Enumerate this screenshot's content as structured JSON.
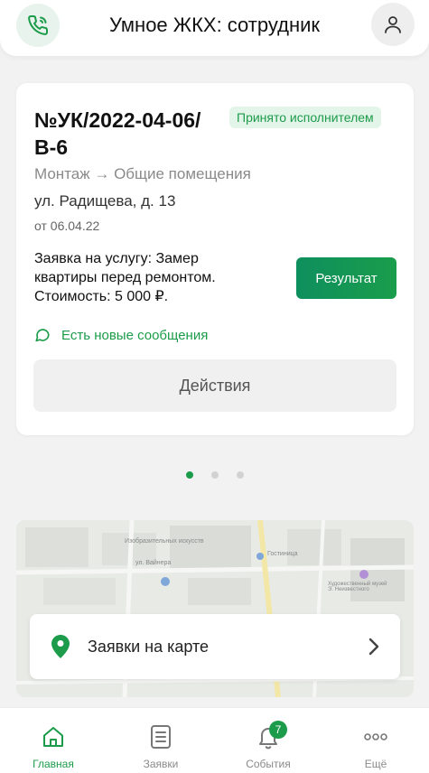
{
  "header": {
    "title": "Умное ЖКХ: сотрудник",
    "left_icon": "phone-icon",
    "right_icon": "user-icon"
  },
  "order_card": {
    "number": "№УК/2022-04-06/В-6",
    "status": "Принято исполнителем",
    "category": "Монтаж → Общие помещения",
    "address": "ул. Радищева, д. 13",
    "date": "от 06.04.22",
    "description": "Заявка на услугу: Замер квартиры перед ремонтом. Стоимость: 5 000 ₽.",
    "result_button": "Результат",
    "messages_notice": "Есть новые сообщения",
    "actions_button": "Действия"
  },
  "pager": {
    "count": 3,
    "active_index": 0
  },
  "map": {
    "label": "Заявки на карте",
    "map_text": [
      "Изобразительных искусств",
      "ул. Вайнера",
      "Художественный музей Э. Неизвестного",
      "Гостиница"
    ]
  },
  "bottom_nav": {
    "items": [
      {
        "label": "Главная",
        "icon": "home-icon",
        "active": true
      },
      {
        "label": "Заявки",
        "icon": "document-icon",
        "active": false
      },
      {
        "label": "События",
        "icon": "bell-icon",
        "active": false,
        "badge": "7"
      },
      {
        "label": "Ещё",
        "icon": "more-dots-icon",
        "active": false
      }
    ]
  },
  "colors": {
    "accent": "#1c9c4b",
    "badge_bg": "#e3f4e8",
    "background": "#f2f2f2"
  }
}
